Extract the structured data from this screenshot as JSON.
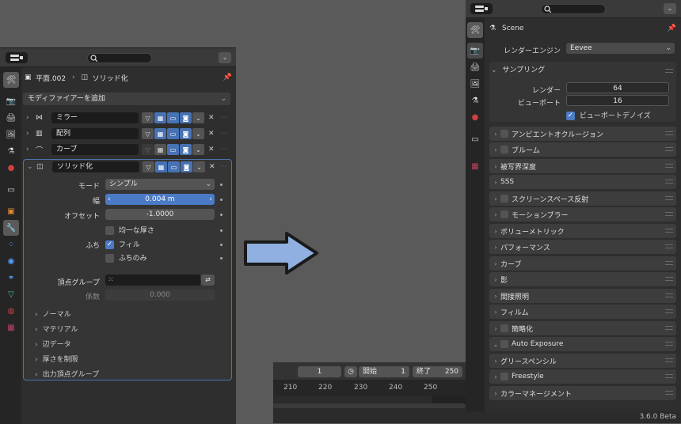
{
  "left": {
    "breadcrumb_object": "平面.002",
    "breadcrumb_modifier": "ソリッド化",
    "add_modifier": "モディファイアーを追加",
    "modifiers": [
      {
        "name": "ミラー"
      },
      {
        "name": "配列"
      },
      {
        "name": "カーブ"
      },
      {
        "name": "ソリッド化"
      }
    ],
    "props": {
      "mode_label": "モード",
      "mode_value": "シンプル",
      "width_label": "幅",
      "width_value": "0.004 m",
      "offset_label": "オフセット",
      "offset_value": "-1.0000",
      "even_thickness": "均一な厚さ",
      "rim_label": "ふち",
      "rim_fill": "フィル",
      "rim_only": "ふちのみ",
      "vgroup_label": "頂点グループ",
      "factor_label": "係数",
      "factor_value": "0.000"
    },
    "subpanels": [
      "ノーマル",
      "マテリアル",
      "辺データ",
      "厚さを制限",
      "出力頂点グループ"
    ]
  },
  "timeline": {
    "current_frame": "1",
    "start_label": "開始",
    "start_value": "1",
    "end_label": "終了",
    "end_value": "250",
    "ticks": [
      "210",
      "220",
      "230",
      "240",
      "250"
    ]
  },
  "right": {
    "context": "Scene",
    "render_engine_label": "レンダーエンジン",
    "render_engine_value": "Eevee",
    "sampling": {
      "title": "サンプリング",
      "render_label": "レンダー",
      "render_value": "64",
      "viewport_label": "ビューポート",
      "viewport_value": "16",
      "denoise": "ビューポートデノイズ"
    },
    "sections": [
      {
        "label": "アンビエントオクルージョン",
        "checkbox": true
      },
      {
        "label": "ブルーム",
        "checkbox": true
      },
      {
        "label": "被写界深度",
        "checkbox": false
      },
      {
        "label": "SSS",
        "checkbox": false
      },
      {
        "label": "スクリーンスペース反射",
        "checkbox": true
      },
      {
        "label": "モーションブラー",
        "checkbox": true
      },
      {
        "label": "ボリューメトリック",
        "checkbox": false
      },
      {
        "label": "パフォーマンス",
        "checkbox": false
      },
      {
        "label": "カーブ",
        "checkbox": false
      },
      {
        "label": "影",
        "checkbox": false
      },
      {
        "label": "間接照明",
        "checkbox": false
      },
      {
        "label": "フィルム",
        "checkbox": false
      },
      {
        "label": "簡略化",
        "checkbox": true
      },
      {
        "label": "Auto Exposure",
        "checkbox": true,
        "expanded": true
      },
      {
        "label": "グリースペンシル",
        "checkbox": false
      },
      {
        "label": "Freestyle",
        "checkbox": true
      },
      {
        "label": "カラーマネージメント",
        "checkbox": false
      }
    ]
  },
  "status": {
    "version": "3.6.0 Beta"
  },
  "colors": {
    "accent": "#4772b3",
    "arrow_fill": "#8fb0e0"
  }
}
